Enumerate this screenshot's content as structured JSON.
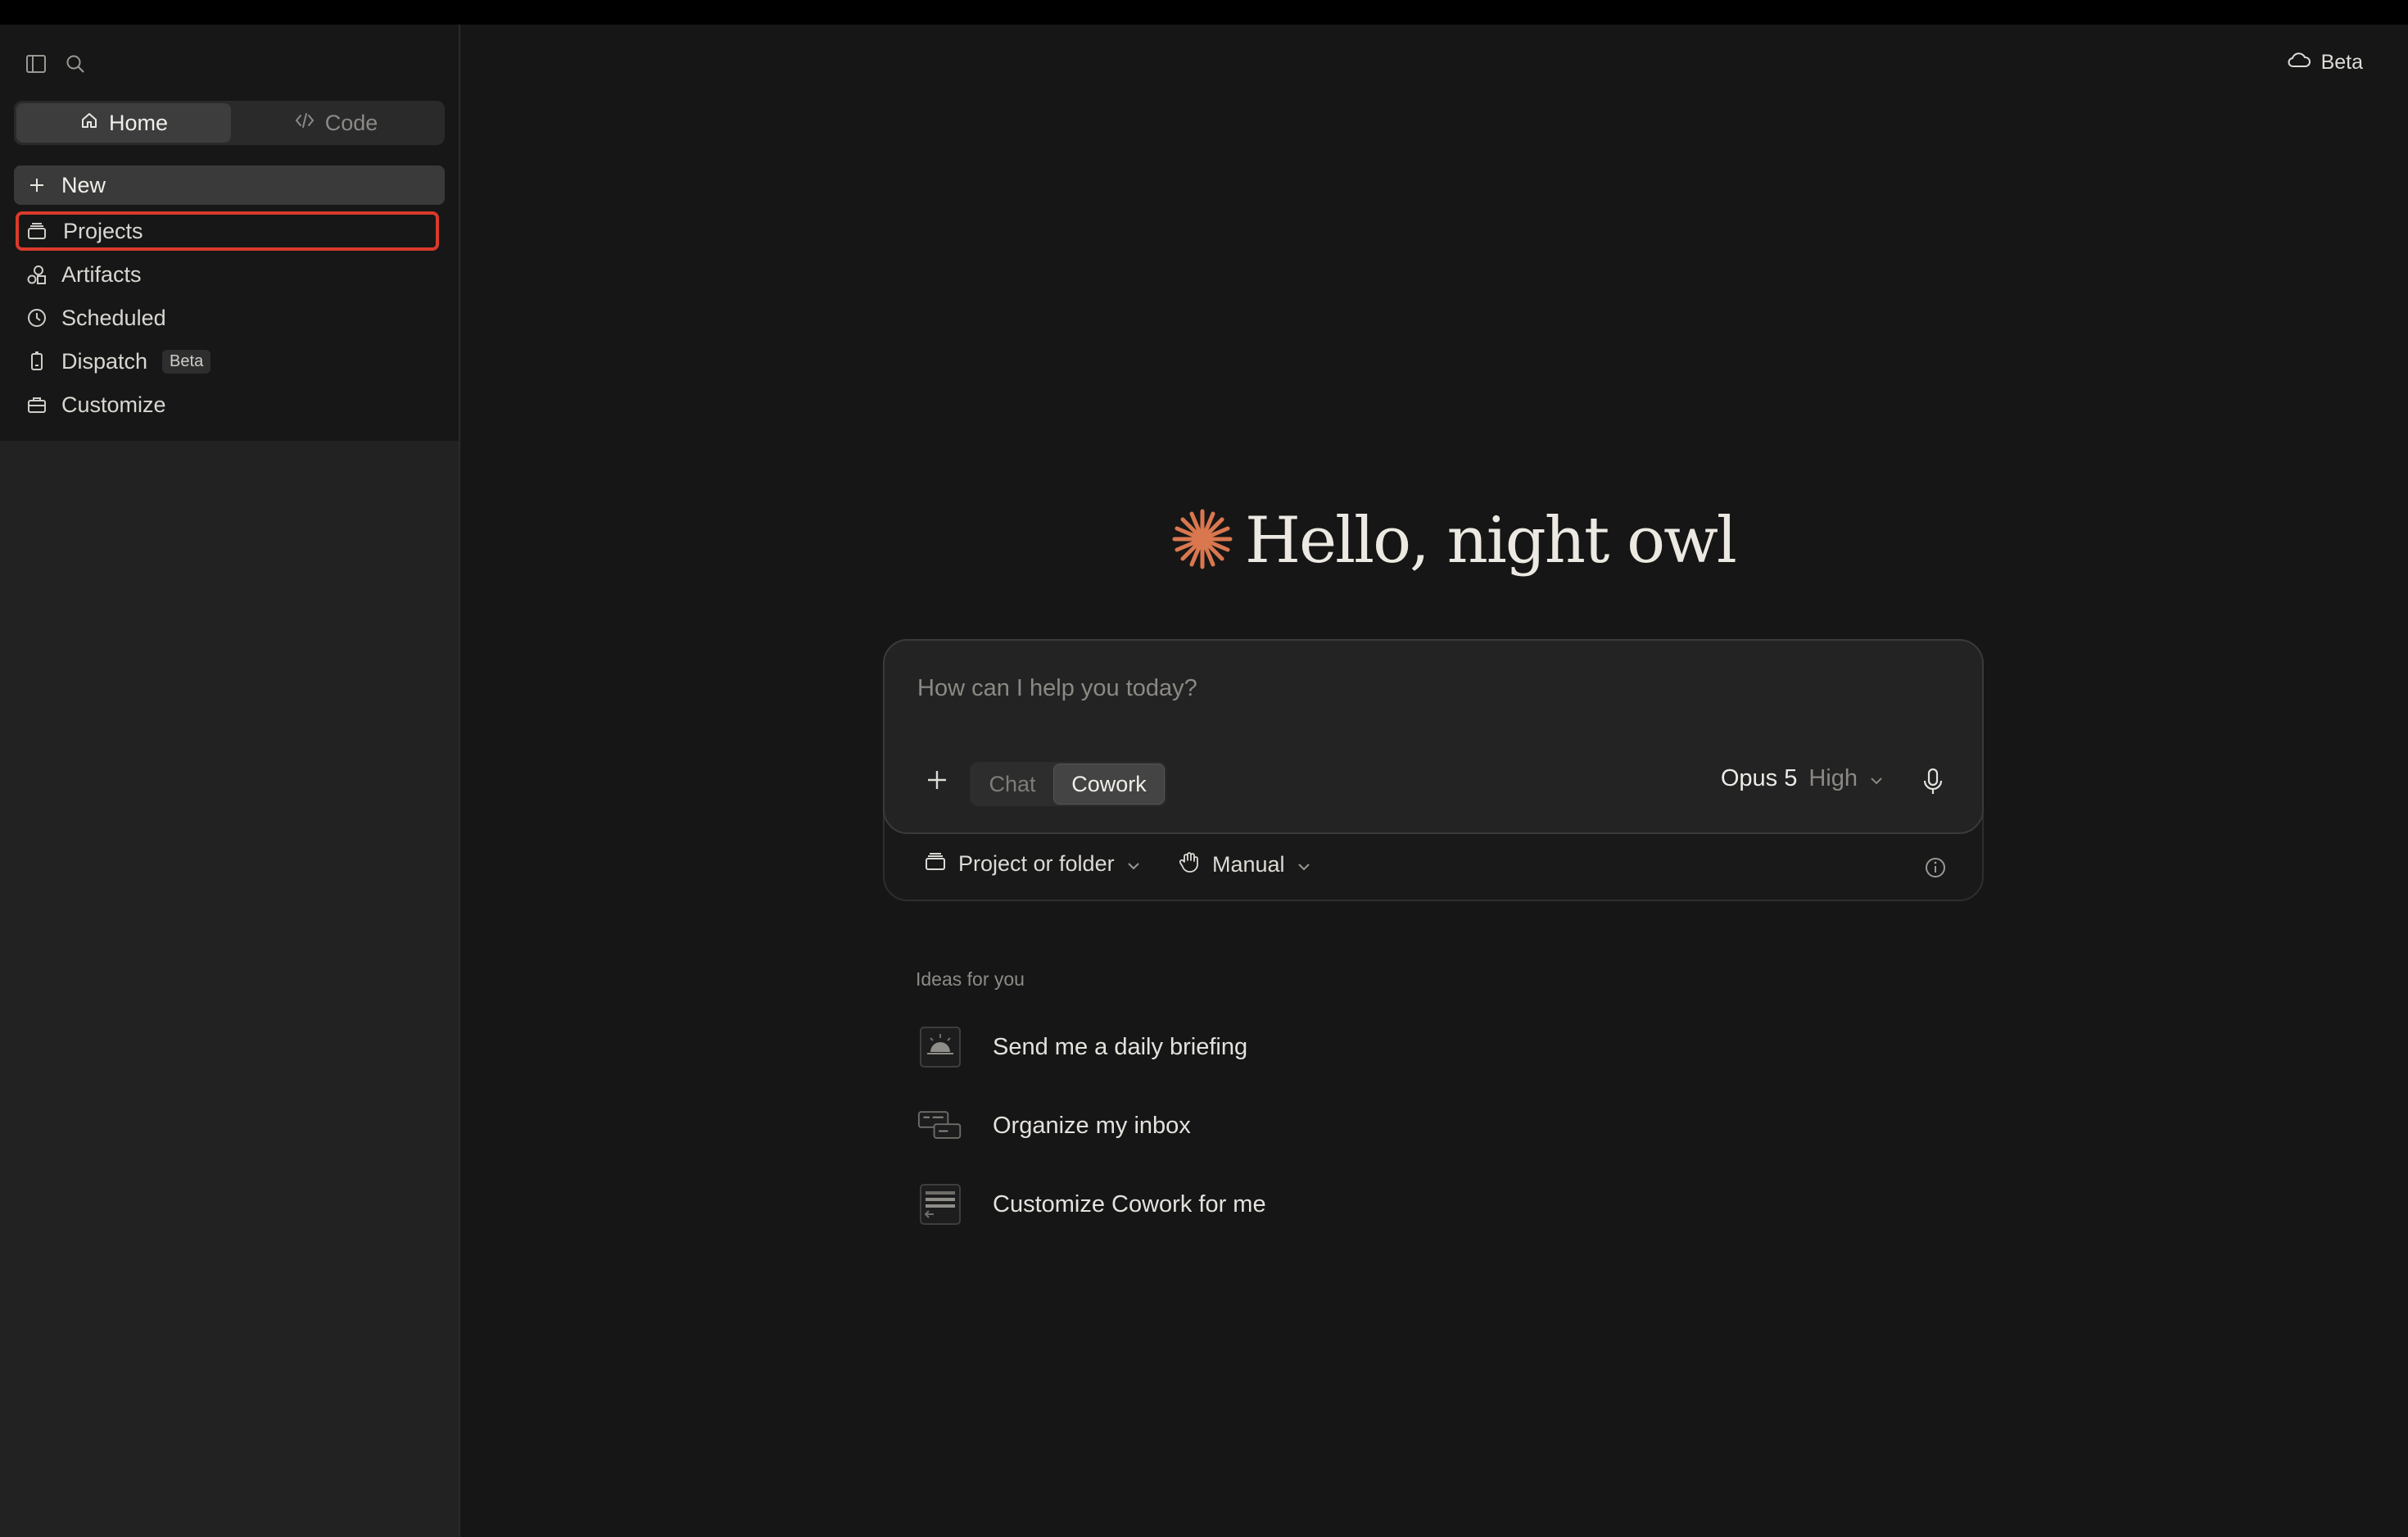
{
  "sidebar": {
    "tabs": [
      {
        "label": "Home",
        "icon": "home-icon"
      },
      {
        "label": "Code",
        "icon": "code-icon"
      }
    ],
    "items": [
      {
        "label": "New",
        "icon": "plus-icon"
      },
      {
        "label": "Projects",
        "icon": "folder-icon"
      },
      {
        "label": "Artifacts",
        "icon": "shapes-icon"
      },
      {
        "label": "Scheduled",
        "icon": "clock-icon"
      },
      {
        "label": "Dispatch",
        "icon": "phone-icon",
        "badge": "Beta"
      },
      {
        "label": "Customize",
        "icon": "briefcase-icon"
      }
    ]
  },
  "header": {
    "beta_label": "Beta"
  },
  "main": {
    "greeting": "Hello, night owl",
    "composer": {
      "placeholder": "How can I help you today?",
      "modes": [
        "Chat",
        "Cowork"
      ],
      "active_mode": "Cowork",
      "model_name": "Opus 5",
      "model_level": "High",
      "project_label": "Project or folder",
      "permission_label": "Manual"
    },
    "ideas": {
      "label": "Ideas for you",
      "items": [
        "Send me a daily briefing",
        "Organize my inbox",
        "Customize Cowork for me"
      ]
    }
  },
  "colors": {
    "accent": "#d9774f",
    "highlight_outline": "#d93a2b",
    "background": "#161616",
    "sidebar": "#171717"
  }
}
